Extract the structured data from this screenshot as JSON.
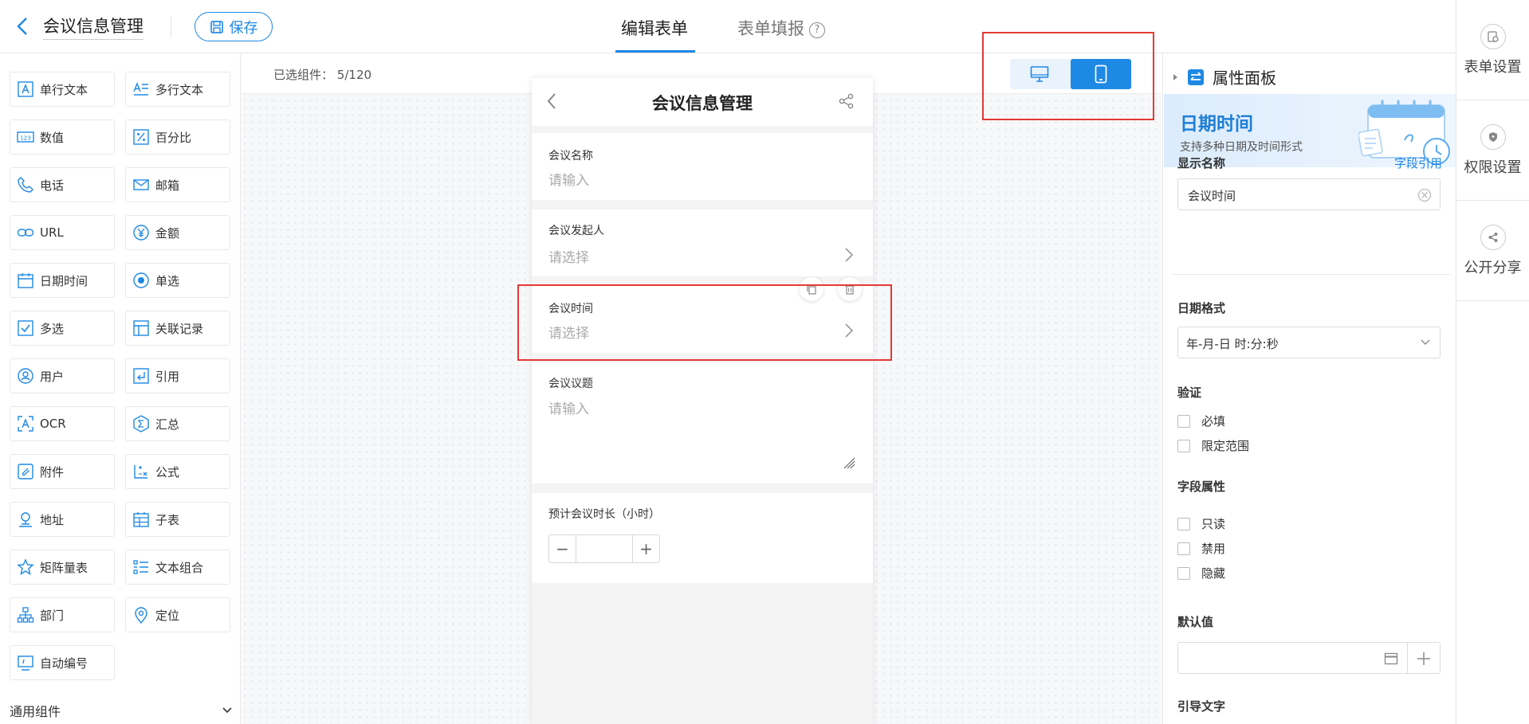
{
  "header": {
    "title": "会议信息管理",
    "save_label": "保存",
    "tabs": [
      {
        "label": "编辑表单",
        "active": true
      },
      {
        "label": "表单填报",
        "active": false
      }
    ],
    "help_glyph": "?"
  },
  "right_nav": [
    {
      "label": "表单设置",
      "icon": "form-settings-icon"
    },
    {
      "label": "权限设置",
      "icon": "shield-icon"
    },
    {
      "label": "公开分享",
      "icon": "share-icon"
    }
  ],
  "components": [
    {
      "label": "单行文本",
      "icon": "single-text-icon"
    },
    {
      "label": "多行文本",
      "icon": "multi-text-icon"
    },
    {
      "label": "数值",
      "icon": "number-icon"
    },
    {
      "label": "百分比",
      "icon": "percent-icon"
    },
    {
      "label": "电话",
      "icon": "phone-icon"
    },
    {
      "label": "邮箱",
      "icon": "mail-icon"
    },
    {
      "label": "URL",
      "icon": "link-icon"
    },
    {
      "label": "金额",
      "icon": "yen-icon"
    },
    {
      "label": "日期时间",
      "icon": "calendar-icon"
    },
    {
      "label": "单选",
      "icon": "radio-icon"
    },
    {
      "label": "多选",
      "icon": "checkbox-icon"
    },
    {
      "label": "关联记录",
      "icon": "relation-icon"
    },
    {
      "label": "用户",
      "icon": "user-icon"
    },
    {
      "label": "引用",
      "icon": "reference-icon"
    },
    {
      "label": "OCR",
      "icon": "ocr-icon"
    },
    {
      "label": "汇总",
      "icon": "sum-icon"
    },
    {
      "label": "附件",
      "icon": "attachment-icon"
    },
    {
      "label": "公式",
      "icon": "formula-icon"
    },
    {
      "label": "地址",
      "icon": "address-icon"
    },
    {
      "label": "子表",
      "icon": "subtable-icon"
    },
    {
      "label": "矩阵量表",
      "icon": "star-icon"
    },
    {
      "label": "文本组合",
      "icon": "text-combo-icon"
    },
    {
      "label": "部门",
      "icon": "org-icon"
    },
    {
      "label": "定位",
      "icon": "location-icon"
    },
    {
      "label": "自动编号",
      "icon": "auto-number-icon"
    }
  ],
  "component_group": {
    "label": "通用组件"
  },
  "canvas": {
    "selected_label": "已选组件：",
    "selected_count": "5/120"
  },
  "colors": {
    "accent": "#1e88e5",
    "highlight": "#e53935"
  },
  "phone": {
    "title": "会议信息管理",
    "fields": [
      {
        "label": "会议名称",
        "placeholder": "请输入"
      },
      {
        "label": "会议发起人",
        "placeholder": "请选择"
      },
      {
        "label": "会议时间",
        "placeholder": "请选择"
      },
      {
        "label": "会议议题",
        "placeholder": "请输入"
      },
      {
        "label": "预计会议时长（小时）",
        "minus": "−",
        "plus": "+"
      }
    ]
  },
  "properties": {
    "panel_title": "属性面板",
    "banner_title": "日期时间",
    "banner_subtitle": "支持多种日期及时间形式",
    "display_name_label": "显示名称",
    "field_ref_link": "字段引用",
    "display_name_value": "会议时间",
    "date_format_label": "日期格式",
    "date_format_value": "年-月-日 时:分:秒",
    "validation_label": "验证",
    "validation_options": [
      "必填",
      "限定范围"
    ],
    "field_attr_label": "字段属性",
    "field_attr_options": [
      "只读",
      "禁用",
      "隐藏"
    ],
    "default_label": "默认值",
    "guide_label": "引导文字"
  }
}
